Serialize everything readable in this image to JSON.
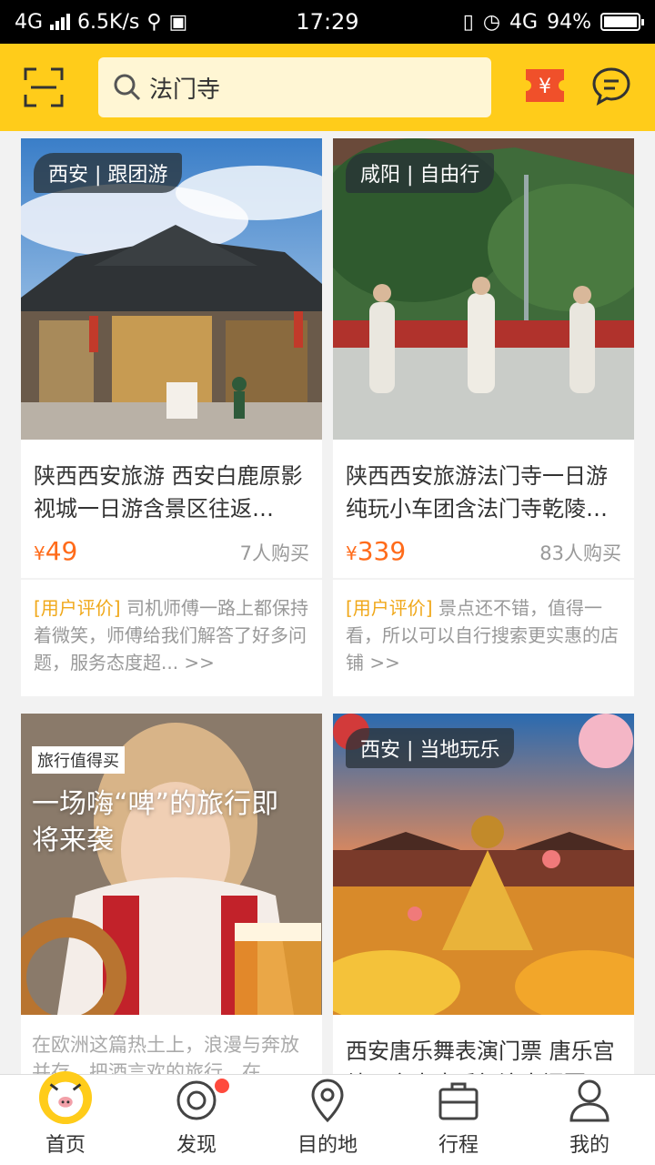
{
  "status_bar": {
    "network": "4G",
    "speed": "6.5K/s",
    "time": "17:29",
    "network_right": "4G",
    "battery": "94%",
    "battery_level": 0.94
  },
  "search": {
    "value": "法门寺"
  },
  "cards": [
    {
      "tag": "西安 | 跟团游",
      "title": "陕西西安旅游 西安白鹿原影视城一日游含景区往返…",
      "price_symbol": "¥",
      "price": "49",
      "buyers": "7人购买",
      "review_label": "[用户评价]",
      "review": "司机师傅一路上都保持着微笑，师傅给我们解答了好多问题，服务态度超... >>"
    },
    {
      "tag": "咸阳 | 自由行",
      "title": "陕西西安旅游法门寺一日游纯玩小车团含法门寺乾陵…",
      "price_symbol": "¥",
      "price": "339",
      "buyers": "83人购买",
      "review_label": "[用户评价]",
      "review": "景点还不错，值得一看，所以可以自行搜索更实惠的店铺 >>"
    },
    {
      "badge": "旅行值得买",
      "promo_title": "一场嗨“啤”的旅行即将来袭",
      "desc": "在欧洲这篇热土上，浪漫与奔放并存，把酒言欢的旅行，在"
    },
    {
      "tag": "西安 | 当地玩乐",
      "title": "西安唐乐舞表演门票 唐乐宫结子宫大唐乐舞演出门票"
    }
  ],
  "tabs": [
    {
      "label": "首页",
      "active": true
    },
    {
      "label": "发现",
      "badge_dot": true
    },
    {
      "label": "目的地"
    },
    {
      "label": "行程"
    },
    {
      "label": "我的"
    }
  ],
  "colors": {
    "brand_yellow": "#ffcc1a",
    "price_orange": "#ff6b1a",
    "review_label": "#f0a81a",
    "ticket_red": "#f0502a"
  }
}
